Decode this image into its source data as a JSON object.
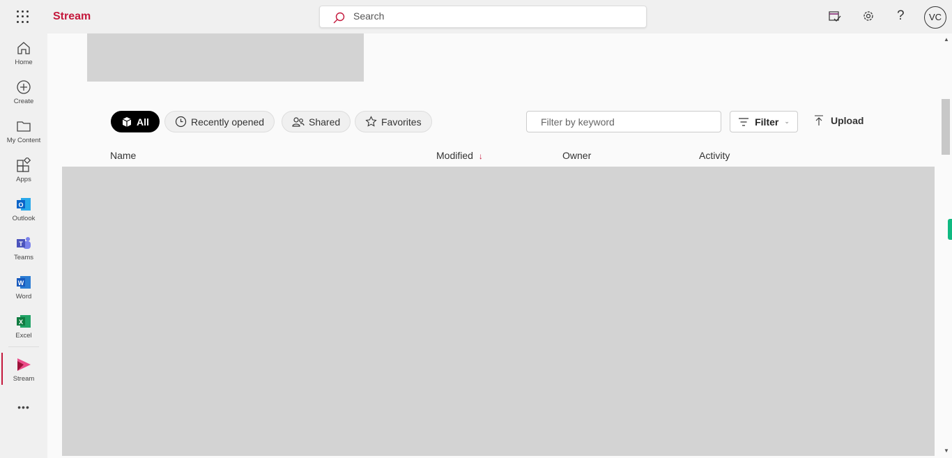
{
  "header": {
    "app_name": "Stream",
    "search_placeholder": "Search",
    "avatar_initials": "VC"
  },
  "rail": {
    "items": [
      {
        "label": "Home",
        "icon": "home-icon"
      },
      {
        "label": "Create",
        "icon": "plus-circle-icon"
      },
      {
        "label": "My Content",
        "icon": "folder-icon"
      },
      {
        "label": "Apps",
        "icon": "apps-icon"
      },
      {
        "label": "Outlook",
        "icon": "outlook-icon"
      },
      {
        "label": "Teams",
        "icon": "teams-icon"
      },
      {
        "label": "Word",
        "icon": "word-icon"
      },
      {
        "label": "Excel",
        "icon": "excel-icon"
      },
      {
        "label": "Stream",
        "icon": "stream-icon",
        "selected": true
      }
    ],
    "more": "•••"
  },
  "filters": {
    "pills": [
      "All",
      "Recently opened",
      "Shared",
      "Favorites"
    ],
    "active": "All",
    "keyword_placeholder": "Filter by keyword",
    "filter_label": "Filter",
    "upload_label": "Upload"
  },
  "table": {
    "columns": [
      "Name",
      "Modified",
      "Owner",
      "Activity"
    ],
    "sort_column": "Modified",
    "sort_direction": "descending"
  },
  "colors": {
    "brand": "#c4183c",
    "active_pill": "#000000"
  }
}
